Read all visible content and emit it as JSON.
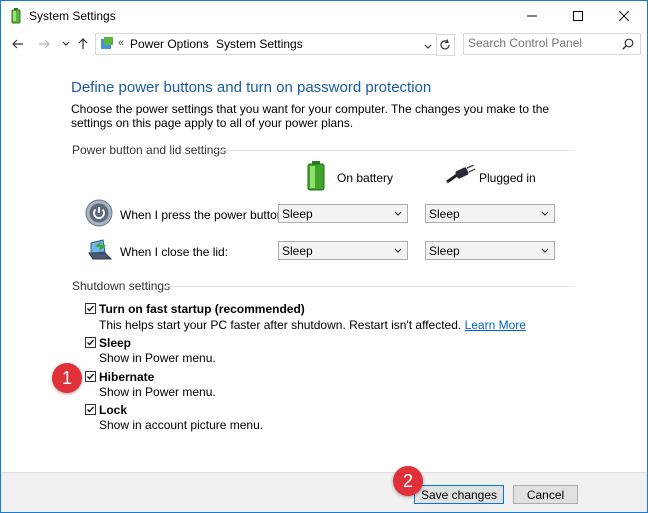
{
  "window": {
    "title": "System Settings"
  },
  "address": {
    "separator_lead": "«",
    "crumbs": [
      "Power Options",
      "System Settings"
    ],
    "separator": "›"
  },
  "search": {
    "placeholder": "Search Control Panel"
  },
  "page": {
    "heading": "Define power buttons and turn on password protection",
    "intro": "Choose the power settings that you want for your computer. The changes you make to the settings on this page apply to all of your power plans."
  },
  "power_section": {
    "title": "Power button and lid settings",
    "col_battery": "On battery",
    "col_plugged": "Plugged in",
    "rows": [
      {
        "label": "When I press the power button:",
        "battery": "Sleep",
        "plugged": "Sleep"
      },
      {
        "label": "When I close the lid:",
        "battery": "Sleep",
        "plugged": "Sleep"
      }
    ]
  },
  "shutdown_section": {
    "title": "Shutdown settings",
    "items": [
      {
        "label": "Turn on fast startup (recommended)",
        "desc": "This helps start your PC faster after shutdown. Restart isn't affected.",
        "link": "Learn More",
        "checked": true
      },
      {
        "label": "Sleep",
        "desc": "Show in Power menu.",
        "checked": true
      },
      {
        "label": "Hibernate",
        "desc": "Show in Power menu.",
        "checked": true
      },
      {
        "label": "Lock",
        "desc": "Show in account picture menu.",
        "checked": true
      }
    ]
  },
  "markers": {
    "one": "1",
    "two": "2"
  },
  "footer": {
    "save_label": "Save changes",
    "cancel_label": "Cancel"
  },
  "icons": {
    "app": "power-options-icon",
    "back": "back-arrow-icon",
    "forward": "forward-arrow-icon",
    "recent": "chevron-down-icon",
    "up": "up-arrow-icon",
    "refresh": "refresh-icon",
    "search": "search-icon",
    "battery": "battery-icon",
    "plug": "plug-icon",
    "power_button": "power-button-icon",
    "lid": "laptop-lid-icon"
  },
  "colors": {
    "heading": "#1c5aa6",
    "link": "#0066cc",
    "marker": "#e0303a",
    "accent": "#0078d7"
  }
}
